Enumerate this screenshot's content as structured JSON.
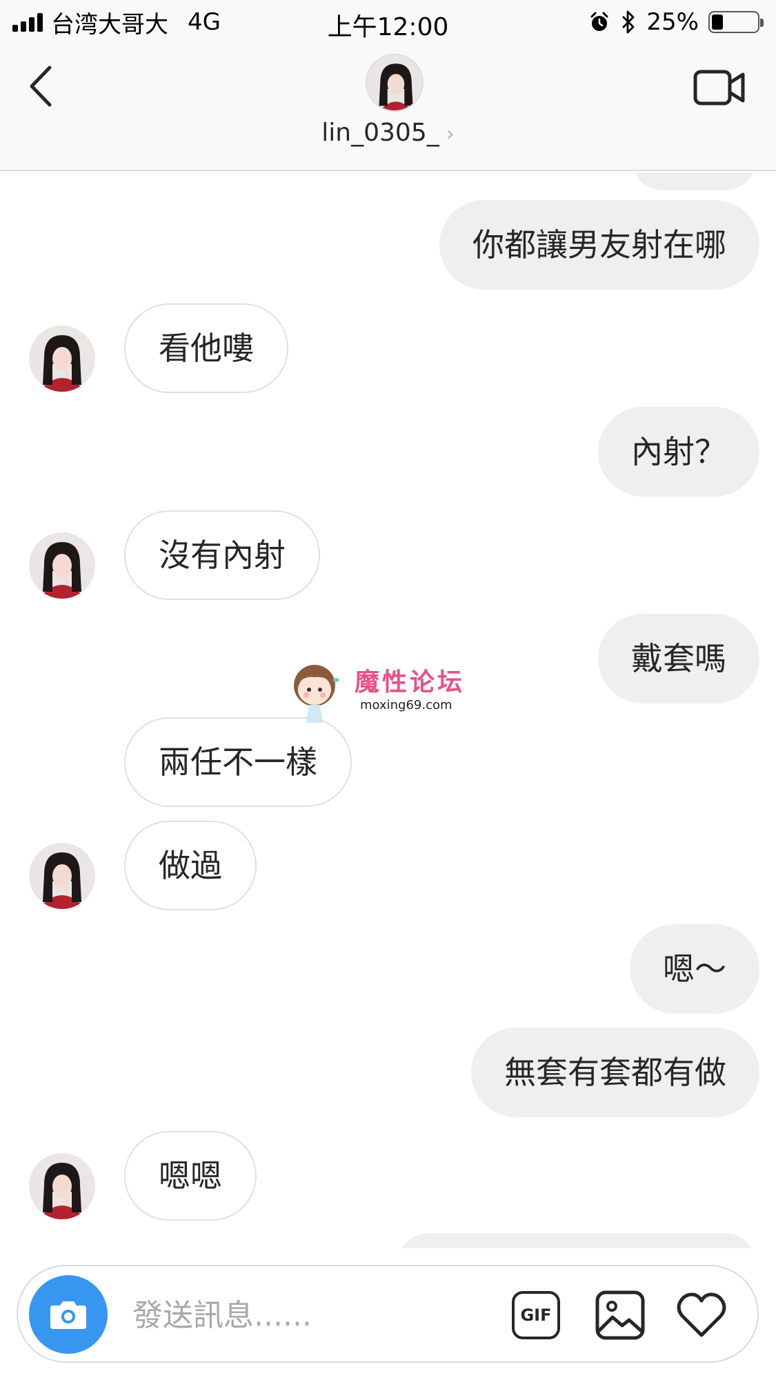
{
  "status_bar": {
    "carrier": "台湾大哥大",
    "network": "4G",
    "time": "上午12:00",
    "battery_percent": "25%",
    "battery_level": 0.25,
    "icons": [
      "signal-icon",
      "alarm-icon",
      "bluetooth-icon",
      "battery-icon"
    ]
  },
  "header": {
    "username": "lin_0305_",
    "chevron": "›",
    "icons": {
      "back": "chevron-left-icon",
      "video": "video-camera-icon"
    }
  },
  "messages": [
    {
      "text": "你都讓男友射在哪",
      "from": "me"
    },
    {
      "text": "看他嘍",
      "from": "them",
      "avatar": true
    },
    {
      "text": "內射？",
      "from": "me"
    },
    {
      "text": "沒有內射",
      "from": "them",
      "avatar": true
    },
    {
      "text": "戴套嗎",
      "from": "me"
    },
    {
      "text": "兩任不一樣",
      "from": "them",
      "avatar": false
    },
    {
      "text": "做過",
      "from": "them",
      "avatar": true
    },
    {
      "text": "嗯～",
      "from": "me"
    },
    {
      "text": "無套有套都有做",
      "from": "me"
    },
    {
      "text": "嗯嗯",
      "from": "them",
      "avatar": true
    }
  ],
  "watermark": {
    "title": "魔性论坛",
    "url": "moxing69.com"
  },
  "composer": {
    "placeholder": "發送訊息......",
    "gif_label": "GIF",
    "icons": {
      "camera": "camera-icon",
      "gallery": "image-icon",
      "like": "heart-icon"
    }
  },
  "colors": {
    "sent_bubble": "#efefef",
    "received_border": "#e0e0e0",
    "camera_button": "#3797f0",
    "watermark_pink": "#e8508a"
  }
}
